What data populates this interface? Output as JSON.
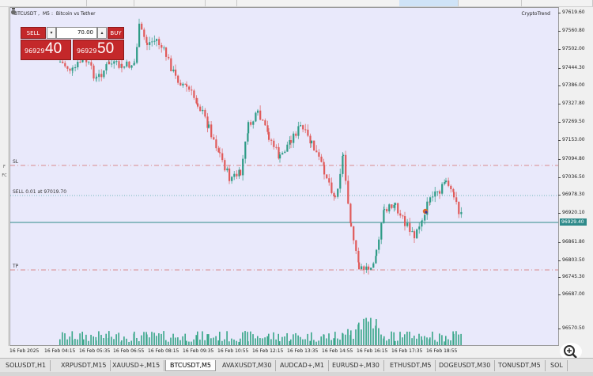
{
  "chart": {
    "symbol": "BTCUSDT",
    "timeframe": "M5",
    "description": "Bitcoin vs Tether",
    "indicator": "CryptoTrend",
    "current_price": "96929.40",
    "price_labels": [
      "97619.60",
      "97560.80",
      "97502.00",
      "97444.30",
      "97386.00",
      "97327.80",
      "97269.50",
      "97153.00",
      "97094.80",
      "97036.50",
      "96978.30",
      "96920.10",
      "96861.80",
      "96803.50",
      "96745.30",
      "96687.00",
      "96570.50"
    ],
    "time_labels": [
      "16 Feb 2025",
      "16 Feb 04:15",
      "16 Feb 05:35",
      "16 Feb 06:55",
      "16 Feb 08:15",
      "16 Feb 09:35",
      "16 Feb 10:55",
      "16 Feb 12:15",
      "16 Feb 13:35",
      "16 Feb 14:55",
      "16 Feb 16:15",
      "16 Feb 17:35",
      "16 Feb 18:55"
    ],
    "sl_label": "SL",
    "position_label": "SELL 0.01 at 97019.70",
    "tp_label": "TP",
    "colors": {
      "bull": "#2e9b86",
      "bear": "#e05a5a",
      "sl_tp": "#d46b6b",
      "position": "#4aa6a6",
      "current": "#2e8a8a",
      "volume": "#38a688",
      "background": "#e9e9fb"
    }
  },
  "trade_panel": {
    "sell_label": "SELL",
    "buy_label": "BUY",
    "lot_value": "70.00",
    "sell_price_small": "96929",
    "sell_price_big": "40",
    "buy_price_small": "96929",
    "buy_price_big": "50"
  },
  "tabs": [
    {
      "label": "SOLUSDT,H1",
      "active": false
    },
    {
      "label": "XRPUSDT,M15",
      "active": false
    },
    {
      "label": "XAUUSD+,M15",
      "active": false
    },
    {
      "label": "BTCUSDT,M5",
      "active": true
    },
    {
      "label": "AVAXUSDT,M30",
      "active": false
    },
    {
      "label": "AUDCAD+,M1",
      "active": false
    },
    {
      "label": "EURUSD+,M30",
      "active": false
    },
    {
      "label": "ETHUSDT,M5",
      "active": false
    },
    {
      "label": "DOGEUSDT,M30",
      "active": false
    },
    {
      "label": "TONUSDT,M5",
      "active": false
    },
    {
      "label": "SOL",
      "active": false
    }
  ],
  "left_tools": [
    "F",
    "FC"
  ]
}
